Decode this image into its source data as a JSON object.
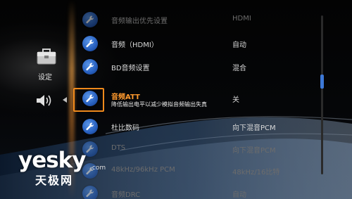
{
  "side_menu": {
    "settings_label": "设定",
    "icons": [
      "toolbox-icon",
      "speaker-icon",
      "arrow-left-icon"
    ]
  },
  "rows": [
    {
      "label": "音频输出优先设置",
      "value": "HDMI",
      "state": "dim"
    },
    {
      "label": "音频（HDMI）",
      "value": "自动",
      "state": "normal"
    },
    {
      "label": "BD音频设置",
      "value": "混合",
      "state": "normal"
    },
    {
      "label": "音频ATT",
      "value": "关",
      "state": "selected",
      "description": "降低输出电平以减少模拟音频输出失真"
    },
    {
      "label": "杜比数码",
      "value": "向下混音PCM",
      "state": "normal"
    },
    {
      "label": "DTS",
      "value": "向下混音PCM",
      "state": "dim"
    },
    {
      "label": "48kHz/96kHz PCM",
      "value": "48kHz/16比特",
      "state": "dim"
    },
    {
      "label": "音频DRC",
      "value": "自动",
      "state": "dim"
    }
  ],
  "row_icon": "wrench-icon",
  "scrollbar": {
    "position_fraction": 0.37
  },
  "watermark": {
    "letters": "yesky",
    "cn": "天极网",
    "com": ".com"
  },
  "colors": {
    "highlight": "#ff9a2e",
    "selection_frame": "#f08a1c",
    "icon_blue": "#2a63c2",
    "scroll_thumb": "#3d78d6"
  }
}
